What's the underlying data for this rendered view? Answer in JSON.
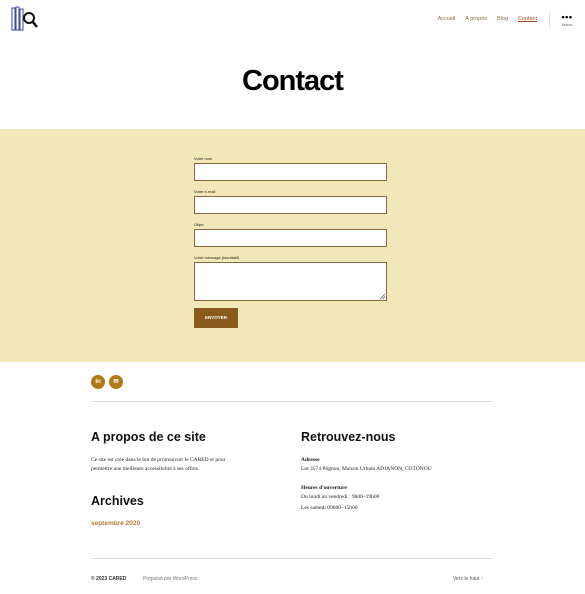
{
  "header": {
    "logo_icon": "magnifier-books-logo-icon",
    "nav": [
      {
        "label": "Accueil"
      },
      {
        "label": "A propos"
      },
      {
        "label": "Blog"
      },
      {
        "label": "Contact",
        "active": true
      }
    ],
    "menu_label": "Menu",
    "menu_icon": "ellipsis-icon"
  },
  "page": {
    "title": "Contact"
  },
  "form": {
    "name_label": "Votre nom",
    "email_label": "Votre e-mail",
    "subject_label": "Objet",
    "message_label": "Votre message (facultatif)",
    "submit_label": "ENVOYER"
  },
  "social": [
    {
      "icon": "linkedin-icon",
      "glyph": "in"
    },
    {
      "icon": "mail-icon",
      "glyph": "✉"
    }
  ],
  "about": {
    "title": "A propos de ce site",
    "text_line1": "Ce site est créé dans le but de promouvoir le CARED et pour",
    "text_line2": "permettre une meilleure accessibilité à ses offres."
  },
  "archives": {
    "title": "Archives",
    "items": [
      "septembre 2020"
    ]
  },
  "find_us": {
    "title": "Retrouvez-nous",
    "address_label": "Adresse",
    "address_value": "Lot 3574 Pôgnon, Maison Urbain ADJANON, COTONOU",
    "hours_label": "Heures d'ouverture",
    "hours_line1": "Du lundi au vendredi : 9h00–19h00",
    "hours_line2": "Les samedi 09h00–15h00"
  },
  "footer": {
    "copyright": "© 2023 CARED",
    "powered": "Propulsé par WordPress",
    "back_to_top": "Vers le haut ↑"
  },
  "colors": {
    "band": "#f2e7b8",
    "accent": "#8a5a1a",
    "social": "#b27a14"
  }
}
